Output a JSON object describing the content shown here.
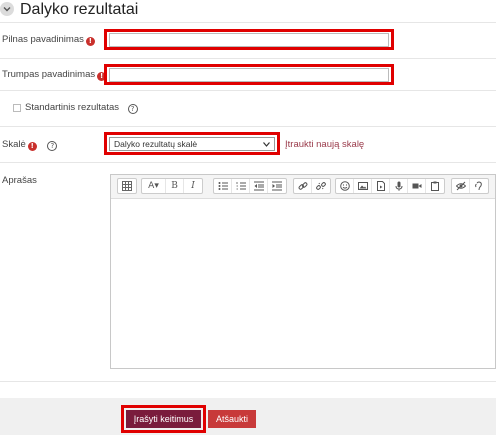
{
  "header": {
    "title": "Dalyko rezultatai"
  },
  "form": {
    "fullname": {
      "label": "Pilnas pavadinimas",
      "value": ""
    },
    "shortname": {
      "label": "Trumpas pavadinimas",
      "value": ""
    },
    "standard": {
      "label": "Standartinis rezultatas",
      "checked": false
    },
    "scale": {
      "label": "Skalė",
      "selected": "Dalyko rezultatų skalė",
      "add_link": "Įtraukti naują skalę"
    },
    "description": {
      "label": "Aprašas",
      "value": ""
    }
  },
  "editor_toolbar": [
    [
      "table-icon"
    ],
    [
      "font-size-icon",
      "bold-icon",
      "italic-icon"
    ],
    [
      "bullet-list-icon",
      "numbered-list-icon",
      "outdent-icon",
      "indent-icon"
    ],
    [
      "link-icon",
      "unlink-icon"
    ],
    [
      "emoji-icon",
      "image-icon",
      "media-icon",
      "microphone-icon",
      "video-icon",
      "paste-icon"
    ],
    [
      "accessibility-check-icon",
      "screen-reader-icon"
    ]
  ],
  "footer": {
    "save_label": "Įrašyti keitimus",
    "cancel_label": "Atšaukti"
  },
  "colors": {
    "highlight": "#e00000",
    "required": "#c9302c",
    "primary": "#7a1c3c",
    "secondary": "#c83a3a",
    "link": "#9a3a4a"
  }
}
